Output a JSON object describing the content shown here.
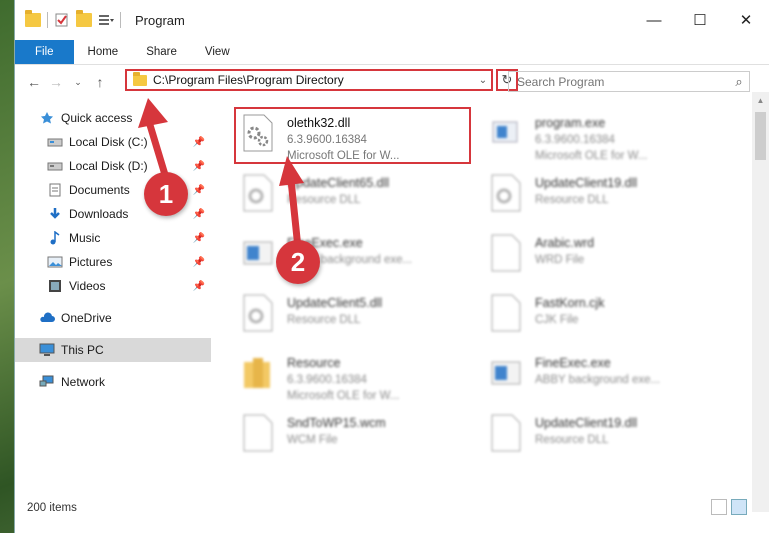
{
  "window": {
    "title": "Program",
    "controls": {
      "minimize": "—",
      "maximize": "☐",
      "close": "✕"
    }
  },
  "ribbon": {
    "tabs": [
      "File",
      "Home",
      "Share",
      "View"
    ]
  },
  "nav": {
    "address": "C:\\Program Files\\Program Directory",
    "search_placeholder": "Search Program"
  },
  "sidebar": {
    "items": [
      {
        "label": "Quick access",
        "icon": "star-icon"
      },
      {
        "label": "Local Disk (C:)",
        "icon": "drive-icon"
      },
      {
        "label": "Local Disk (D:)",
        "icon": "drive-icon"
      },
      {
        "label": "Documents",
        "icon": "documents-icon"
      },
      {
        "label": "Downloads",
        "icon": "download-icon"
      },
      {
        "label": "Music",
        "icon": "music-icon"
      },
      {
        "label": "Pictures",
        "icon": "pictures-icon"
      },
      {
        "label": "Videos",
        "icon": "videos-icon"
      },
      {
        "label": "OneDrive",
        "icon": "cloud-icon"
      },
      {
        "label": "This PC",
        "icon": "computer-icon"
      },
      {
        "label": "Network",
        "icon": "network-icon"
      }
    ]
  },
  "files": [
    {
      "name": "olethk32.dll",
      "line1": "6.3.9600.16384",
      "line2": "Microsoft OLE for W...",
      "icon": "dll-gear-icon"
    },
    {
      "name": "program.exe",
      "line1": "6.3.9600.16384",
      "line2": "Microsoft OLE for W...",
      "icon": "exe-icon"
    },
    {
      "name": "UpdateClient65.dll",
      "line1": "Resource DLL",
      "line2": "",
      "icon": "dll-gear-icon"
    },
    {
      "name": "UpdateClient19.dll",
      "line1": "Resource DLL",
      "line2": "",
      "icon": "dll-gear-icon"
    },
    {
      "name": "FineExec.exe",
      "line1": "ABBY background exe...",
      "line2": "",
      "icon": "exe-window-icon"
    },
    {
      "name": "Arabic.wrd",
      "line1": "WRD File",
      "line2": "",
      "icon": "blank-file-icon"
    },
    {
      "name": "UpdateClient5.dll",
      "line1": "Resource DLL",
      "line2": "",
      "icon": "dll-gear-icon"
    },
    {
      "name": "FastKorn.cjk",
      "line1": "CJK File",
      "line2": "",
      "icon": "blank-file-icon"
    },
    {
      "name": "Resource",
      "line1": "6.3.9600.16384",
      "line2": "Microsoft OLE for W...",
      "icon": "folder-icon"
    },
    {
      "name": "FineExec.exe",
      "line1": "ABBY background exe...",
      "line2": "",
      "icon": "exe-window-icon"
    },
    {
      "name": "SndToWP15.wcm",
      "line1": "WCM File",
      "line2": "",
      "icon": "blank-file-icon"
    },
    {
      "name": "UpdateClient19.dll",
      "line1": "Resource DLL",
      "line2": "",
      "icon": "dll-gear-icon"
    }
  ],
  "status": {
    "count": "200 items"
  },
  "annotations": {
    "step1": "1",
    "step2": "2"
  },
  "colors": {
    "accent": "#1979ca",
    "highlight": "#d6363c"
  }
}
